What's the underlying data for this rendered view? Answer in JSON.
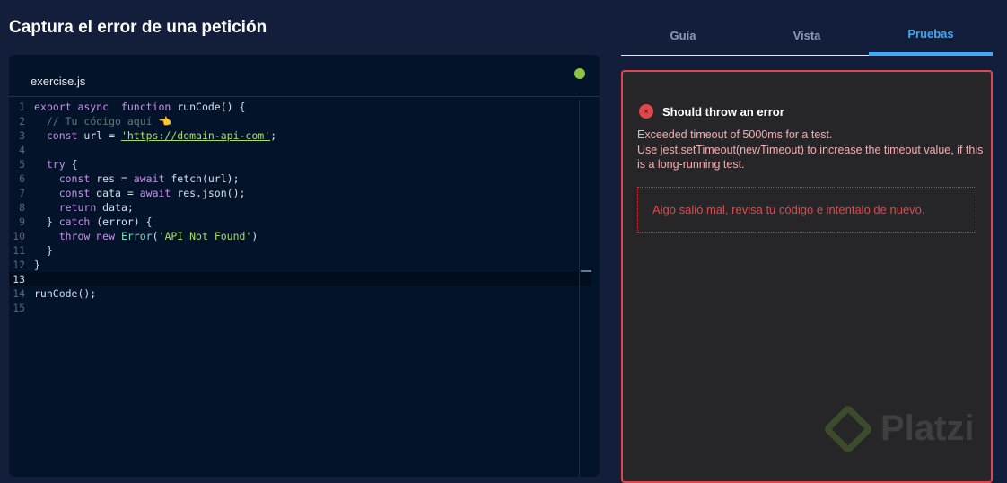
{
  "title": "Captura el error de una petición",
  "editor": {
    "filename": "exercise.js",
    "status_color": "#8bc43f",
    "active_line": 13,
    "lines": [
      [
        [
          "export async  function ",
          "k"
        ],
        [
          "runCode() {",
          "p"
        ]
      ],
      [
        [
          "  ",
          "p"
        ],
        [
          "// Tu código aquí 👈",
          "c"
        ]
      ],
      [
        [
          "  ",
          "p"
        ],
        [
          "const ",
          "k"
        ],
        [
          "url = ",
          "p"
        ],
        [
          "'https://domain-api-com'",
          "s u"
        ],
        [
          ";",
          "p"
        ]
      ],
      [],
      [
        [
          "  ",
          "p"
        ],
        [
          "try ",
          "k"
        ],
        [
          "{",
          "p"
        ]
      ],
      [
        [
          "    ",
          "p"
        ],
        [
          "const ",
          "k"
        ],
        [
          "res = ",
          "p"
        ],
        [
          "await ",
          "k"
        ],
        [
          "fetch(url);",
          "p"
        ]
      ],
      [
        [
          "    ",
          "p"
        ],
        [
          "const ",
          "k"
        ],
        [
          "data = ",
          "p"
        ],
        [
          "await ",
          "k"
        ],
        [
          "res.json();",
          "p"
        ]
      ],
      [
        [
          "    ",
          "p"
        ],
        [
          "return ",
          "k"
        ],
        [
          "data;",
          "p"
        ]
      ],
      [
        [
          "  } ",
          "p"
        ],
        [
          "catch ",
          "k"
        ],
        [
          "(error) {",
          "p"
        ]
      ],
      [
        [
          "    ",
          "p"
        ],
        [
          "throw new ",
          "k"
        ],
        [
          "Error",
          "t"
        ],
        [
          "(",
          "p"
        ],
        [
          "'API Not Found'",
          "s"
        ],
        [
          ")",
          "p"
        ]
      ],
      [
        [
          "  }",
          "p"
        ]
      ],
      [
        [
          "}",
          "p"
        ]
      ],
      [],
      [
        [
          "runCode();",
          "p"
        ]
      ],
      []
    ]
  },
  "tabs": [
    {
      "label": "Guía"
    },
    {
      "label": "Vista"
    },
    {
      "label": "Pruebas",
      "active": true
    }
  ],
  "results": {
    "test_name": "Should throw an error",
    "status_icon": "×",
    "message_lines": [
      "Exceeded timeout of 5000ms for a test.",
      "Use jest.setTimeout(newTimeout) to increase the timeout value, if this is a long-running test."
    ],
    "feedback": "Algo salió mal, revisa tu código e intentalo de nuevo."
  },
  "watermark": "Platzi"
}
